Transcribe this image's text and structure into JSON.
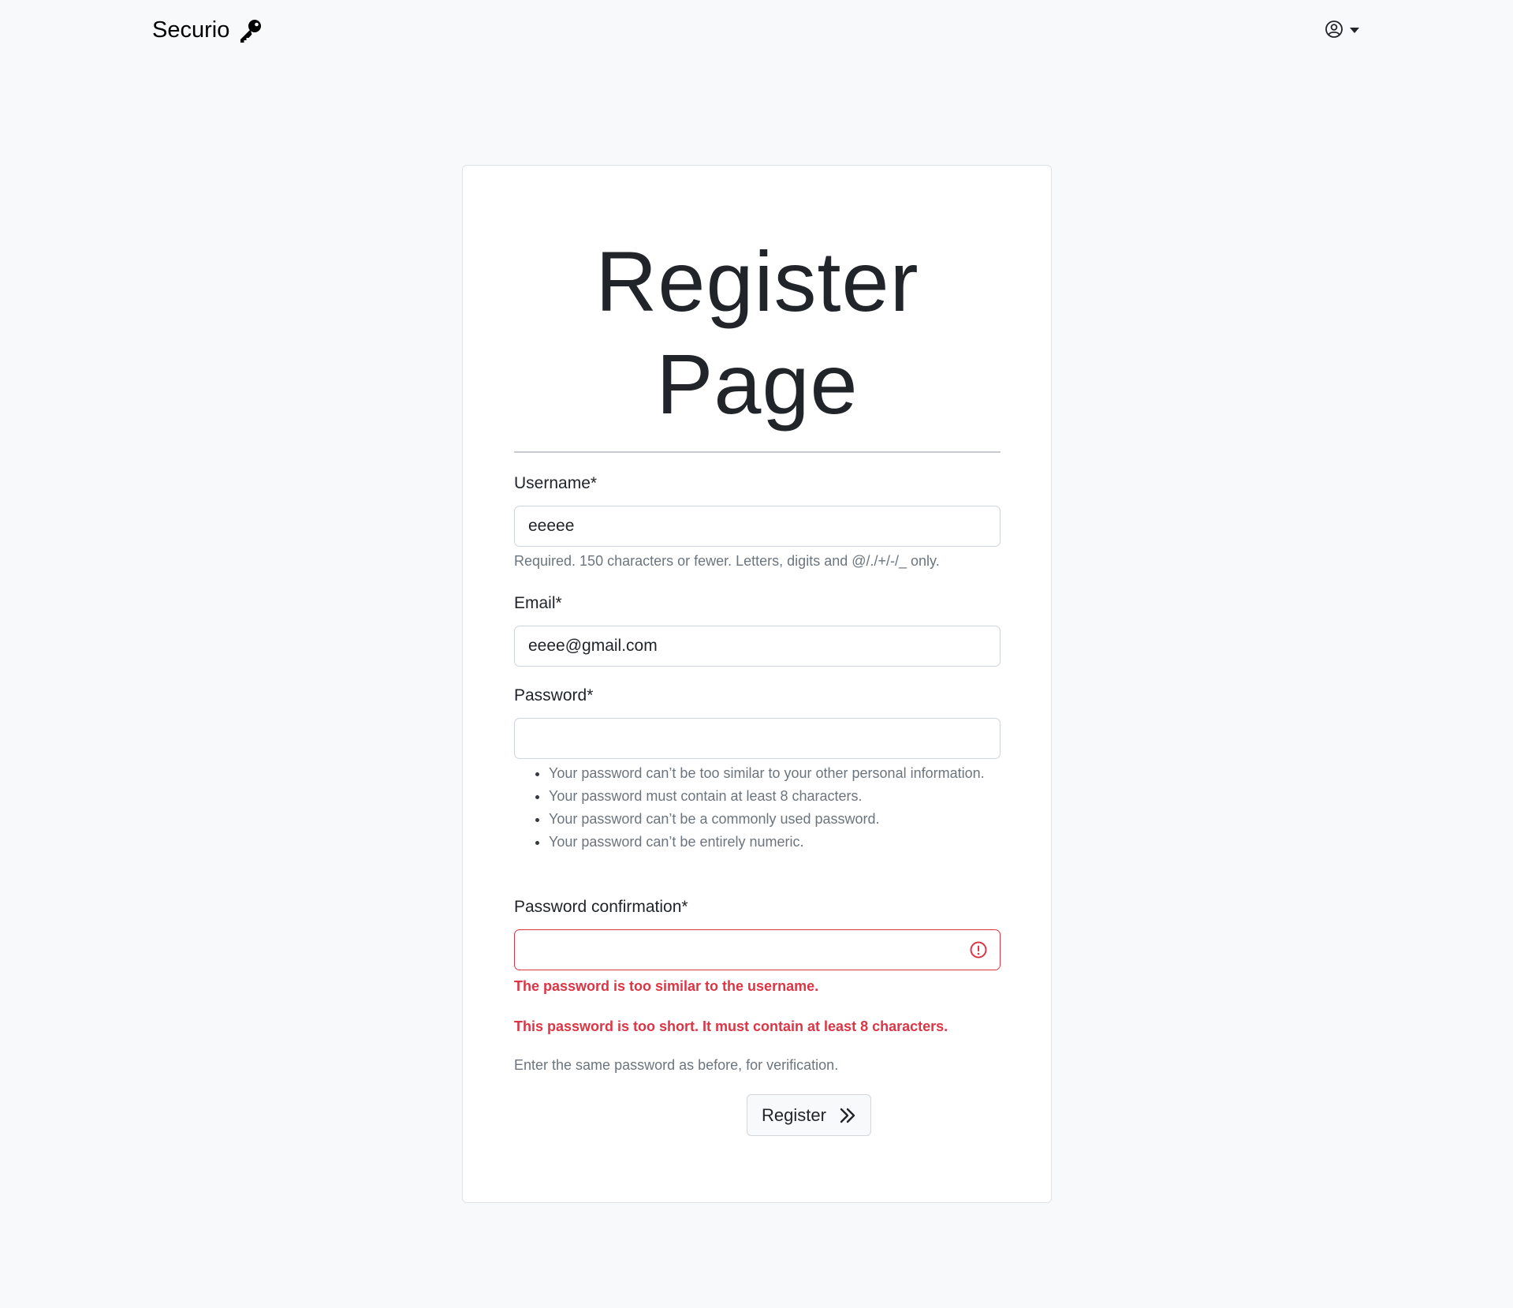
{
  "navbar": {
    "brand": "Securio",
    "brand_icon": "key-icon",
    "user_icon": "user-circle-icon"
  },
  "form": {
    "title_line1": "Register",
    "title_line2": "Page",
    "username": {
      "label": "Username*",
      "value": "eeeee",
      "help": "Required. 150 characters or fewer. Letters, digits and @/./+/-/_ only."
    },
    "email": {
      "label": "Email*",
      "value": "eeee@gmail.com"
    },
    "password": {
      "label": "Password*",
      "value": "",
      "help_items": [
        "Your password can’t be too similar to your other personal information.",
        "Your password must contain at least 8 characters.",
        "Your password can’t be a commonly used password.",
        "Your password can’t be entirely numeric."
      ]
    },
    "password_confirmation": {
      "label": "Password confirmation*",
      "value": "",
      "errors": [
        "The password is too similar to the username.",
        "This password is too short. It must contain at least 8 characters."
      ],
      "help": "Enter the same password as before, for verification."
    },
    "submit_label": "Register"
  },
  "colors": {
    "error": "#dc3545",
    "muted": "#6c757d",
    "background": "#f8f9fa"
  }
}
